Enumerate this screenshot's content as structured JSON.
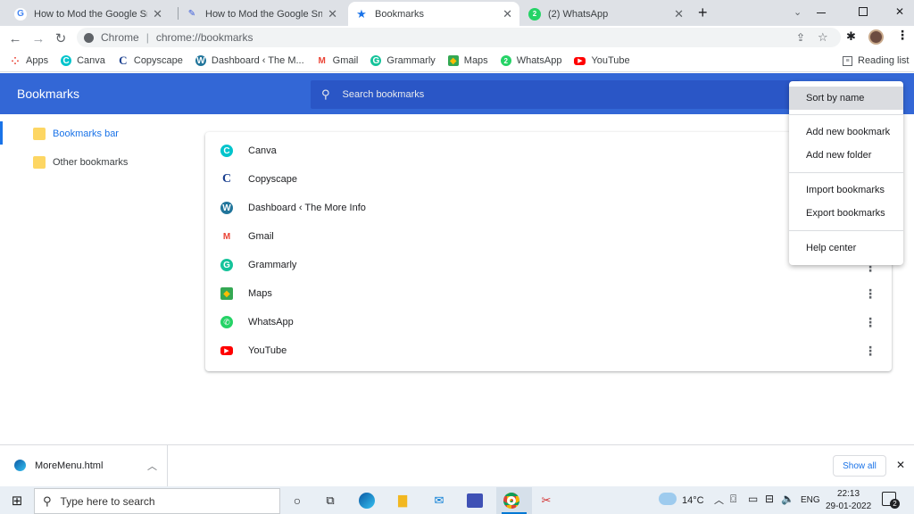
{
  "tabs": [
    {
      "title": "How to Mod the Google Snake G",
      "icon": "google-icon",
      "active": false
    },
    {
      "title": "How to Mod the Google Snake G",
      "icon": "pen-icon",
      "active": false
    },
    {
      "title": "Bookmarks",
      "icon": "star-icon",
      "active": true
    },
    {
      "title": "(2) WhatsApp",
      "icon": "whatsapp-icon",
      "active": false
    }
  ],
  "new_tab": "+",
  "omnibox": {
    "scheme_label": "Chrome",
    "url": "chrome://bookmarks"
  },
  "bookmarks_bar": [
    {
      "label": "Apps",
      "icon": "apps-grid-icon",
      "color": "#ea4335"
    },
    {
      "label": "Canva",
      "icon": "canva-icon",
      "color": "#00c4cc"
    },
    {
      "label": "Copyscape",
      "icon": "copyscape-icon",
      "color": "#1a3f8f"
    },
    {
      "label": "Dashboard ‹ The M...",
      "icon": "wordpress-icon",
      "color": "#21759b"
    },
    {
      "label": "Gmail",
      "icon": "gmail-icon",
      "color": "#ea4335"
    },
    {
      "label": "Grammarly",
      "icon": "grammarly-icon",
      "color": "#15c39a"
    },
    {
      "label": "Maps",
      "icon": "maps-icon",
      "color": "#34a853"
    },
    {
      "label": "WhatsApp",
      "icon": "whatsapp-icon",
      "color": "#25d366"
    },
    {
      "label": "YouTube",
      "icon": "youtube-icon",
      "color": "#ff0000"
    }
  ],
  "reading_list": "Reading list",
  "header": {
    "title": "Bookmarks",
    "search_placeholder": "Search bookmarks"
  },
  "sidebar": [
    {
      "label": "Bookmarks bar",
      "selected": true
    },
    {
      "label": "Other bookmarks",
      "selected": false
    }
  ],
  "bookmark_list": [
    {
      "label": "Canva",
      "icon": "canva-icon",
      "color": "#00c4cc"
    },
    {
      "label": "Copyscape",
      "icon": "copyscape-icon",
      "color": "#1a3f8f"
    },
    {
      "label": "Dashboard ‹ The More Info",
      "icon": "wordpress-icon",
      "color": "#21759b"
    },
    {
      "label": "Gmail",
      "icon": "gmail-icon",
      "color": "#ea4335"
    },
    {
      "label": "Grammarly",
      "icon": "grammarly-icon",
      "color": "#15c39a"
    },
    {
      "label": "Maps",
      "icon": "maps-icon",
      "color": "#34a853"
    },
    {
      "label": "WhatsApp",
      "icon": "whatsapp-icon",
      "color": "#25d366"
    },
    {
      "label": "YouTube",
      "icon": "youtube-icon",
      "color": "#ff0000"
    }
  ],
  "menu": {
    "sort": "Sort by name",
    "add_bookmark": "Add new bookmark",
    "add_folder": "Add new folder",
    "import": "Import bookmarks",
    "export": "Export bookmarks",
    "help": "Help center"
  },
  "download": {
    "filename": "MoreMenu.html",
    "show_all": "Show all"
  },
  "taskbar": {
    "search_placeholder": "Type here to search",
    "temperature": "14°C",
    "language": "ENG",
    "time": "22:13",
    "date": "29-01-2022",
    "notification_count": "2"
  },
  "colors": {
    "accent": "#3367d6",
    "search_bg": "#2a56c6",
    "link_blue": "#1a73e8"
  }
}
